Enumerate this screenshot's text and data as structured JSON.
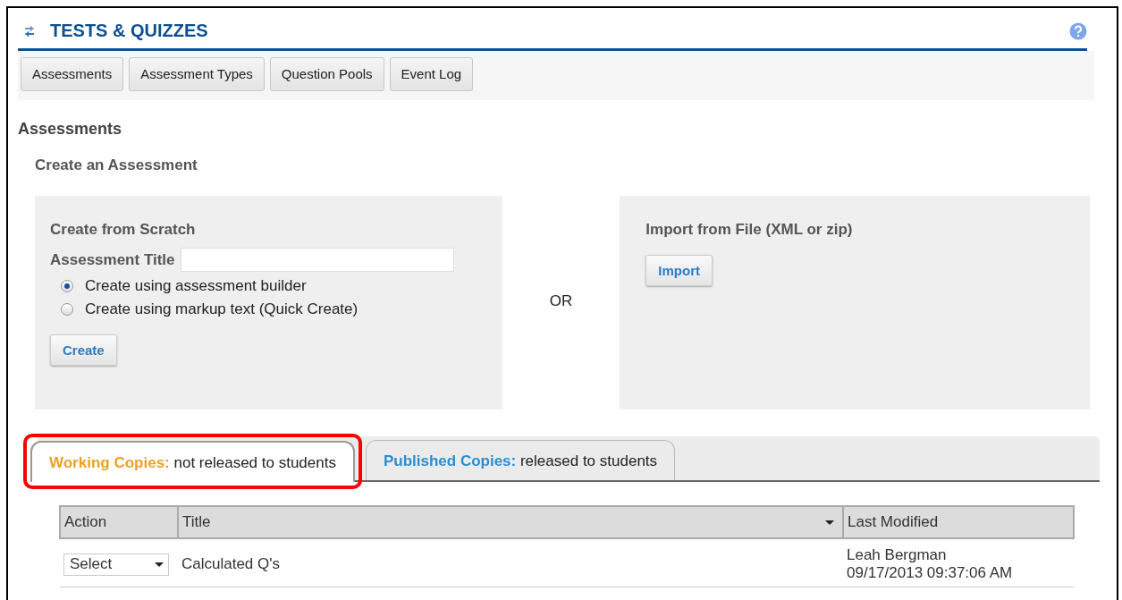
{
  "tool_title": "TESTS & QUIZZES",
  "nav_buttons": [
    "Assessments",
    "Assessment Types",
    "Question Pools",
    "Event Log"
  ],
  "page_heading": "Assessments",
  "section_heading": "Create an Assessment",
  "scratch_panel": {
    "title": "Create from Scratch",
    "field_label": "Assessment Title",
    "options": [
      {
        "label": "Create using assessment builder",
        "selected": true
      },
      {
        "label": "Create using markup text (Quick Create)",
        "selected": false
      }
    ],
    "button": "Create"
  },
  "or_text": "OR",
  "import_panel": {
    "title": "Import from File (XML or zip)",
    "button": "Import"
  },
  "tabs": [
    {
      "label": "Working Copies:",
      "description": "not released to students",
      "selected": true,
      "highlighted": true
    },
    {
      "label": "Published Copies:",
      "description": "released to students",
      "selected": false,
      "highlighted": false
    }
  ],
  "table": {
    "columns": [
      {
        "label": "Action",
        "sortable": false
      },
      {
        "label": "Title",
        "sortable": true
      },
      {
        "label": "Last Modified",
        "sortable": false
      }
    ],
    "rows": [
      {
        "action": "Select",
        "title": "Calculated Q's",
        "modified_by": "Leah Bergman",
        "modified_at": "09/17/2013 09:37:06 AM"
      }
    ]
  }
}
